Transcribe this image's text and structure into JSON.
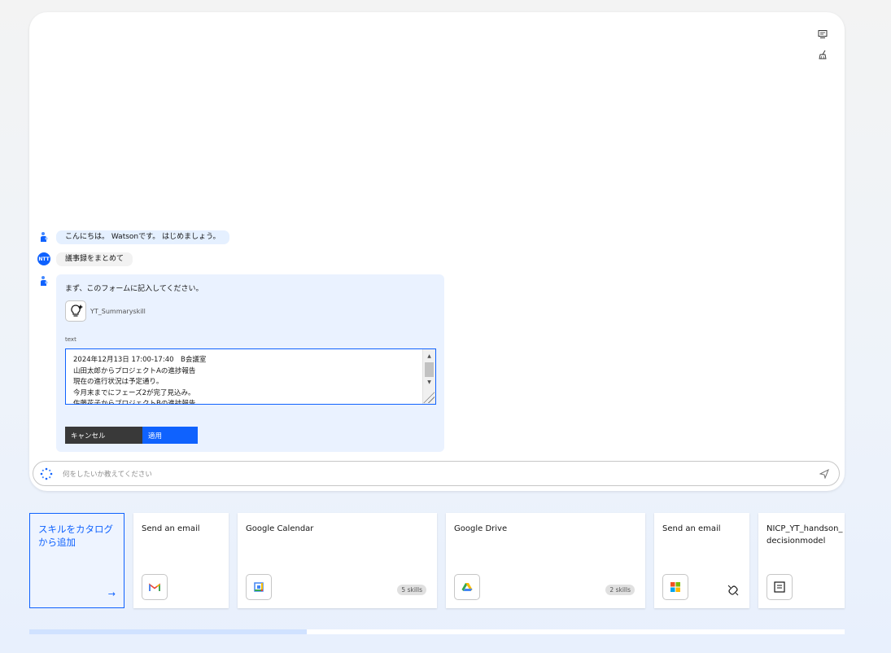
{
  "header_icons": [
    {
      "name": "notes-icon"
    },
    {
      "name": "clear-chat-icon"
    }
  ],
  "chat": {
    "messages": [
      {
        "role": "bot",
        "text": "こんにちは。 Watsonです。 はじめましょう。"
      },
      {
        "role": "user",
        "avatar": "NTT",
        "text": "議事録をまとめて"
      },
      {
        "role": "bot",
        "text": "まず、このフォームに記入してください。"
      }
    ],
    "form": {
      "skill_name": "YT_Summaryskill",
      "field_label": "text",
      "field_value": "2024年12月13日 17:00-17:40　B会議室\n山田太郎からプロジェクトAの進捗報告\n現在の進行状況は予定通り。\n今月末までにフェーズ2が完了見込み。\n佐藤花子からプロジェクトBの進捗報告",
      "cancel_label": "キャンセル",
      "apply_label": "適用"
    },
    "input_placeholder": "何をしたいか教えてください"
  },
  "catalog": {
    "add_tile_label": "スキルをカタログから追加",
    "add_tile_arrow": "→",
    "tiles": [
      {
        "title": "Send an email",
        "logo": "gmail-icon",
        "badge": ""
      },
      {
        "title": "Google Calendar",
        "logo": "google-calendar-icon",
        "badge": "5 skills"
      },
      {
        "title": "Google Drive",
        "logo": "google-drive-icon",
        "badge": "2 skills"
      },
      {
        "title": "Send an email",
        "logo": "microsoft-icon",
        "badge": ""
      },
      {
        "title": "NICP_YT_handson_\ndecisionmodel",
        "logo": "decision-model-icon",
        "badge": ""
      }
    ]
  },
  "scroll_progress": 0.34,
  "colors": {
    "accent": "#0f62fe",
    "bot_bubble": "#e5f0ff",
    "form_bg": "#eaf2ff",
    "cancel_button": "#393939"
  }
}
